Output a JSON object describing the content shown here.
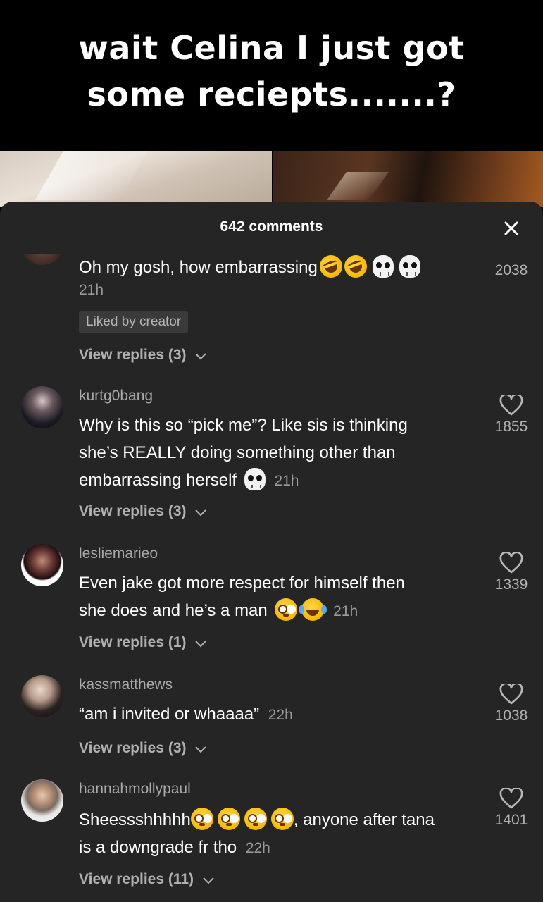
{
  "caption": {
    "text": "wait Celina I just got some reciepts.......?"
  },
  "sheet": {
    "title": "642 comments",
    "close_icon": "close-icon"
  },
  "comments": [
    {
      "username": "",
      "text": "Oh my gosh, how embarrassing",
      "emojis": [
        "rofl",
        "rofl",
        "skull",
        "skull"
      ],
      "time": "21h",
      "badge": "Liked by creator",
      "replies": "View replies (3)",
      "likes": "2038"
    },
    {
      "username": "kurtg0bang",
      "text_lines": [
        "Why is this so “pick me”? Like sis is thinking",
        "she’s REALLY doing something other than",
        "embarrassing herself"
      ],
      "emojis": [
        "skull"
      ],
      "time": "21h",
      "replies": "View replies (3)",
      "likes": "1855"
    },
    {
      "username": "lesliemarieo",
      "text_lines": [
        "Even jake got more respect for himself then",
        "she does and he’s a man"
      ],
      "emojis": [
        "flushed",
        "joy"
      ],
      "time": "21h",
      "replies": "View replies (1)",
      "likes": "1339"
    },
    {
      "username": "kassmatthews",
      "text": "“am i invited or whaaaa”",
      "time": "22h",
      "replies": "View replies (3)",
      "likes": "1038"
    },
    {
      "username": "hannahmollypaul",
      "text_prefix": "Sheessshhhhh",
      "emojis": [
        "flushed",
        "flushed",
        "flushed",
        "flushed"
      ],
      "text_suffix": ", anyone after tana",
      "text_line2": "is a downgrade fr tho",
      "time": "22h",
      "replies": "View replies (11)",
      "likes": "1401"
    }
  ],
  "colors": {
    "sheet_bg": "#252525",
    "username": "#a9a9a9",
    "secondary": "#9a9a9a"
  }
}
